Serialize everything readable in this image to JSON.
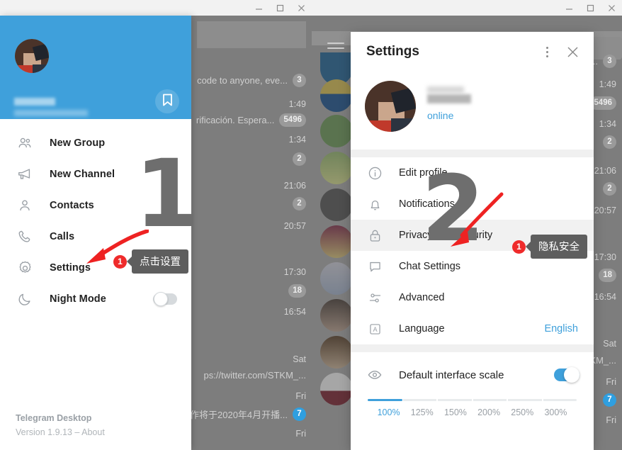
{
  "left_window": {
    "titlebar": {
      "minimize": "minimize-icon",
      "maximize": "maximize-icon",
      "close": "close-icon"
    },
    "profile": {
      "avatar_alt": "user-avatar",
      "saved_messages_icon": "bookmark-icon"
    },
    "menu": {
      "items": [
        {
          "label": "New Group",
          "icon": "group-icon"
        },
        {
          "label": "New Channel",
          "icon": "megaphone-icon"
        },
        {
          "label": "Contacts",
          "icon": "person-icon"
        },
        {
          "label": "Calls",
          "icon": "phone-icon"
        },
        {
          "label": "Settings",
          "icon": "gear-icon"
        },
        {
          "label": "Night Mode",
          "icon": "moon-icon",
          "toggle": "off"
        }
      ]
    },
    "footer": {
      "app_name": "Telegram Desktop",
      "version": "Version 1.9.13 – About"
    },
    "callout": {
      "number": "1",
      "tip": "点击设置"
    },
    "step_number": "1",
    "chat_list": {
      "rows": [
        {
          "time": "",
          "snippet": "code to anyone, eve...",
          "badge": "3"
        },
        {
          "time": "1:49",
          "snippet": "rificación. Espera...",
          "badge": "5496"
        },
        {
          "time": "1:34",
          "snippet": "",
          "badge": "2"
        },
        {
          "time": "21:06",
          "snippet": "",
          "badge": "2"
        },
        {
          "time": "20:57",
          "snippet": "",
          "badge": ""
        },
        {
          "time": "17:30",
          "snippet": "",
          "badge": "18"
        },
        {
          "time": "16:54",
          "snippet": "",
          "badge": ""
        },
        {
          "time": "Sat",
          "snippet": "ps://twitter.com/STKM_...",
          "badge": ""
        },
        {
          "time": "Fri",
          "snippet": "作将于2020年4月开播...",
          "badge": "7"
        },
        {
          "time": "Fri",
          "snippet": "",
          "badge": ""
        }
      ]
    }
  },
  "right_window": {
    "titlebar": {
      "minimize": "minimize-icon",
      "maximize": "maximize-icon",
      "close": "close-icon"
    },
    "dialog": {
      "title": "Settings",
      "menu_icon": "more-vertical-icon",
      "close_icon": "close-icon",
      "profile": {
        "status": "online",
        "avatar_alt": "user-avatar"
      },
      "items": [
        {
          "label": "Edit profile",
          "icon": "info-icon",
          "value": "",
          "highlighted": false
        },
        {
          "label": "Notifications",
          "icon": "bell-icon",
          "value": "",
          "highlighted": false
        },
        {
          "label": "Privacy and Security",
          "icon": "lock-icon",
          "value": "",
          "highlighted": true
        },
        {
          "label": "Chat Settings",
          "icon": "chat-icon",
          "value": "",
          "highlighted": false
        },
        {
          "label": "Advanced",
          "icon": "sliders-icon",
          "value": "",
          "highlighted": false
        },
        {
          "label": "Language",
          "icon": "language-icon",
          "value": "English",
          "highlighted": false
        }
      ],
      "scale": {
        "label": "Default interface scale",
        "icon": "eye-icon",
        "toggle": "on",
        "options": [
          "100%",
          "125%",
          "150%",
          "200%",
          "250%",
          "300%"
        ],
        "selected": "100%"
      }
    },
    "callout": {
      "number": "1",
      "tip": "隐私安全"
    },
    "step_number": "2",
    "chat_list": {
      "rows": [
        {
          "time": "",
          "snippet": "a...",
          "badge": "3"
        },
        {
          "time": "1:49",
          "snippet": "",
          "badge": "5496"
        },
        {
          "time": "1:34",
          "snippet": "",
          "badge": "2"
        },
        {
          "time": "21:06",
          "snippet": "",
          "badge": "2"
        },
        {
          "time": "20:57",
          "snippet": "",
          "badge": ""
        },
        {
          "time": "17:30",
          "snippet": "",
          "badge": "18"
        },
        {
          "time": "16:54",
          "snippet": "",
          "badge": ""
        },
        {
          "time": "Sat",
          "snippet": "KM_...",
          "badge": ""
        },
        {
          "time": "Fri",
          "snippet": "",
          "badge": "7"
        },
        {
          "time": "Fri",
          "snippet": "",
          "badge": ""
        }
      ]
    }
  },
  "colors": {
    "brand_blue": "#3fa0db",
    "callout_red": "#ef2b2b",
    "tooltip_gray": "#5e5e5e",
    "backdrop_gray": "#7d7d7d",
    "step_number_gray": "#6e6e6e"
  }
}
